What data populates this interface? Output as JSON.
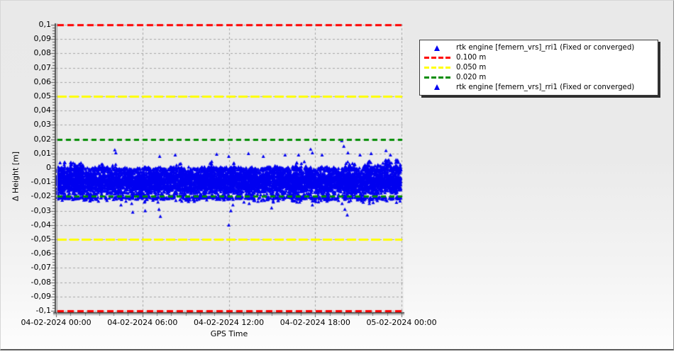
{
  "chart_data": {
    "type": "scatter",
    "title": "",
    "xlabel": "GPS Time",
    "ylabel": "Δ Height [m]",
    "x_tick_labels": [
      "04-02-2024 00:00",
      "04-02-2024 06:00",
      "04-02-2024 12:00",
      "04-02-2024 18:00",
      "05-02-2024 00:00"
    ],
    "y_tick_labels": [
      "0,1",
      "0,09",
      "0,08",
      "0,07",
      "0,06",
      "0,05",
      "0,04",
      "0,03",
      "0,02",
      "0,01",
      "0",
      "-0,01",
      "-0,02",
      "-0,03",
      "-0,04",
      "-0,05",
      "-0,06",
      "-0,07",
      "-0,08",
      "-0,09",
      "-0,1"
    ],
    "ylim": [
      -0.1,
      0.1
    ],
    "x_range": [
      "04-02-2024 00:00",
      "05-02-2024 00:00"
    ],
    "grid": true,
    "decimal_separator_axis": ",",
    "colors": {
      "plot_background": "#ececec",
      "gridline": "#a6a6a6",
      "axis": "#4c4c4c",
      "marker": "#0000f0",
      "threshold_red": "#ff0000",
      "threshold_yellow": "#ffff00",
      "threshold_green": "#008c00"
    },
    "thresholds": [
      {
        "label": "0.100 m",
        "values": [
          0.1,
          -0.1
        ],
        "color": "#ff0000",
        "style": "dashed"
      },
      {
        "label": "0.050 m",
        "values": [
          0.05,
          -0.05
        ],
        "color": "#ffff00",
        "style": "dashed"
      },
      {
        "label": "0.020 m",
        "values": [
          0.02,
          -0.02
        ],
        "color": "#008c00",
        "style": "dashed"
      }
    ],
    "series": [
      {
        "name": "rtk engine [femern_vrs]_rri1 (Fixed or converged)",
        "marker": "triangle-up",
        "color": "#0000f0",
        "band": {
          "description": "dense noise band of RTK height residuals spanning the full 24 h",
          "mean": -0.0095,
          "sd": 0.005,
          "top_typical": 0.0,
          "bottom_typical": -0.021,
          "peak_max": 0.019,
          "trough_min": -0.04
        },
        "outliers_high": [
          [
            0.17,
            0.0125
          ],
          [
            0.173,
            0.0105
          ],
          [
            0.3,
            0.008
          ],
          [
            0.345,
            0.009
          ],
          [
            0.465,
            0.0095
          ],
          [
            0.5,
            0.008
          ],
          [
            0.557,
            0.01
          ],
          [
            0.6,
            0.008
          ],
          [
            0.663,
            0.009
          ],
          [
            0.702,
            0.009
          ],
          [
            0.737,
            0.013
          ],
          [
            0.742,
            0.0105
          ],
          [
            0.77,
            0.009
          ],
          [
            0.827,
            0.019
          ],
          [
            0.833,
            0.015
          ],
          [
            0.845,
            0.0105
          ],
          [
            0.88,
            0.009
          ],
          [
            0.912,
            0.01
          ],
          [
            0.955,
            0.012
          ],
          [
            0.968,
            0.009
          ]
        ],
        "outliers_low": [
          [
            0.188,
            -0.026
          ],
          [
            0.219,
            -0.025
          ],
          [
            0.222,
            -0.031
          ],
          [
            0.256,
            -0.024
          ],
          [
            0.258,
            -0.03
          ],
          [
            0.295,
            -0.024
          ],
          [
            0.298,
            -0.029
          ],
          [
            0.302,
            -0.034
          ],
          [
            0.5,
            -0.04
          ],
          [
            0.506,
            -0.03
          ],
          [
            0.512,
            -0.026
          ],
          [
            0.544,
            -0.024
          ],
          [
            0.559,
            -0.025
          ],
          [
            0.624,
            -0.028
          ],
          [
            0.629,
            -0.024
          ],
          [
            0.705,
            -0.024
          ],
          [
            0.742,
            -0.026
          ],
          [
            0.748,
            -0.023
          ],
          [
            0.828,
            -0.025
          ],
          [
            0.836,
            -0.029
          ],
          [
            0.843,
            -0.033
          ],
          [
            0.907,
            -0.025
          ],
          [
            0.93,
            -0.023
          ]
        ]
      }
    ],
    "legend": {
      "position": "right-of-plot",
      "entries": [
        {
          "type": "marker",
          "color": "#0000f0",
          "label": "rtk engine [femern_vrs]_rri1 (Fixed or converged)"
        },
        {
          "type": "dash",
          "color": "#ff0000",
          "label": "0.100 m"
        },
        {
          "type": "dash",
          "color": "#ffff00",
          "label": "0.050 m"
        },
        {
          "type": "dash",
          "color": "#008c00",
          "label": "0.020 m"
        },
        {
          "type": "marker",
          "color": "#0000f0",
          "label": "rtk engine [femern_vrs]_rri1 (Fixed or converged)"
        }
      ]
    }
  }
}
